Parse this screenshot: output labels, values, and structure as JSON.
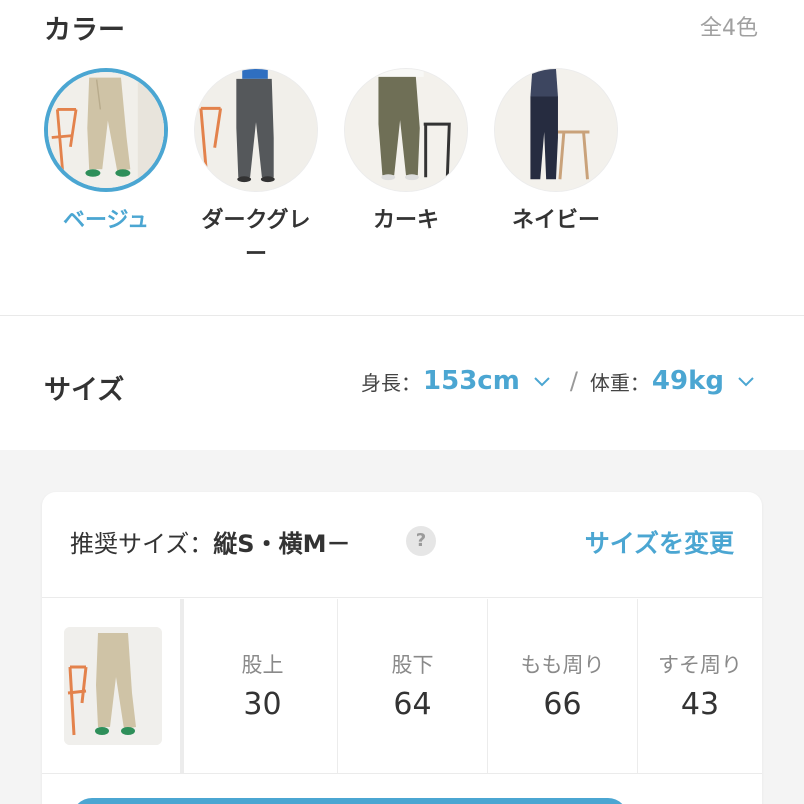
{
  "color": {
    "title": "カラー",
    "count": "全4色",
    "options": [
      {
        "label": "ベージュ",
        "selected": true,
        "color": "#cfc3a6"
      },
      {
        "label": "ダークグレー",
        "selected": false,
        "color": "#55585b"
      },
      {
        "label": "カーキ",
        "selected": false,
        "color": "#6f6f56"
      },
      {
        "label": "ネイビー",
        "selected": false,
        "color": "#262c40"
      }
    ]
  },
  "size": {
    "title": "サイズ",
    "height_label": "身長：",
    "height_value": "153cm",
    "separator": "/",
    "weight_label": "体重：",
    "weight_value": "49kg"
  },
  "recommend": {
    "label": "推奨サイズ：",
    "value": "縦S・横M－",
    "help_glyph": "?",
    "change_link": "サイズを変更",
    "measurements": [
      {
        "label": "股上",
        "value": "30"
      },
      {
        "label": "股下",
        "value": "64"
      },
      {
        "label": "もも周り",
        "value": "66"
      },
      {
        "label": "すそ周り",
        "value": "43"
      }
    ]
  },
  "colors": {
    "accent": "#4ba6d2",
    "text": "#333333",
    "muted": "#a0a0a0",
    "gray_bg": "#f4f4f4"
  }
}
